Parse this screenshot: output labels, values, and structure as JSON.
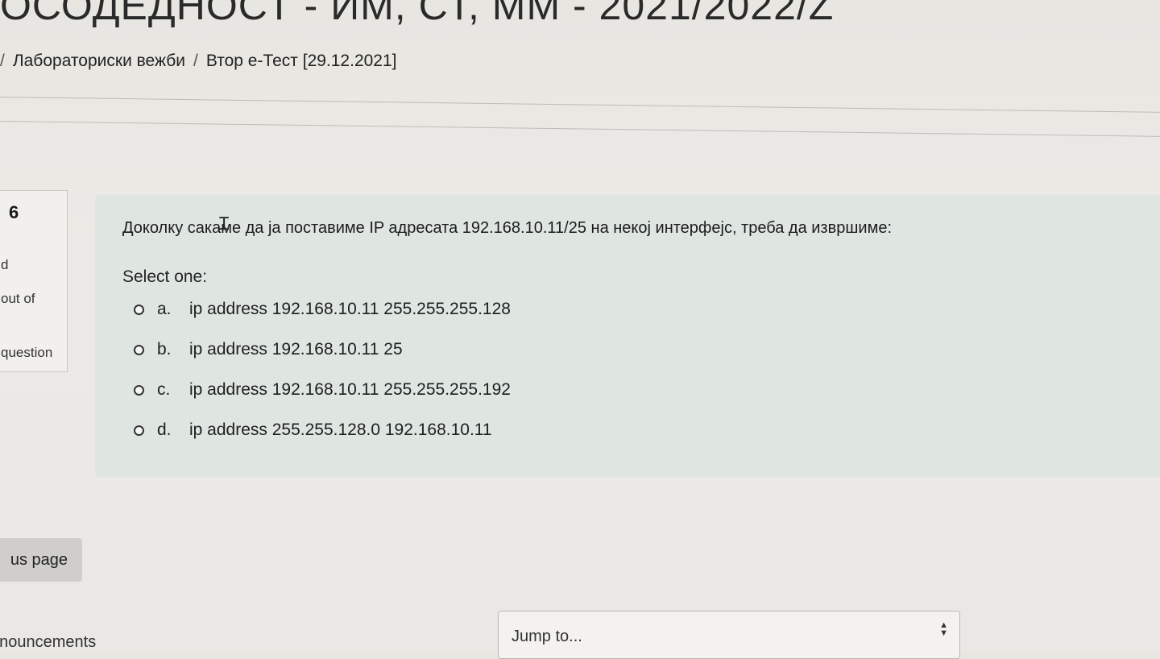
{
  "header": {
    "course_title": "ОСОДЕДНОСТ - ИМ, СТ, ММ - 2021/2022/Z"
  },
  "breadcrumb": {
    "separator": "/",
    "items": [
      "Лабораториски вежби",
      "Втор е-Тест [29.12.2021]"
    ]
  },
  "question_info": {
    "number": "6",
    "status": "d",
    "mark": "out of",
    "flag": "question"
  },
  "question": {
    "text": "Доколку сакаме да ја поставиме IP адресата 192.168.10.11/25 на некој интерфејс, треба да извршиме:",
    "prompt": "Select one:",
    "options": [
      {
        "letter": "a.",
        "text": "ip address 192.168.10.11 255.255.255.128"
      },
      {
        "letter": "b.",
        "text": "ip address 192.168.10.11 25"
      },
      {
        "letter": "c.",
        "text": "ip address 192.168.10.11 255.255.255.192"
      },
      {
        "letter": "d.",
        "text": "ip address 255.255.128.0 192.168.10.11"
      }
    ]
  },
  "navigation": {
    "previous_label": "us page",
    "announcements_label": "nnouncements",
    "jump_label": "Jump to..."
  },
  "icons": {
    "text_cursor": "i-beam-cursor-icon",
    "select_arrows": "up-down-arrows-icon"
  }
}
